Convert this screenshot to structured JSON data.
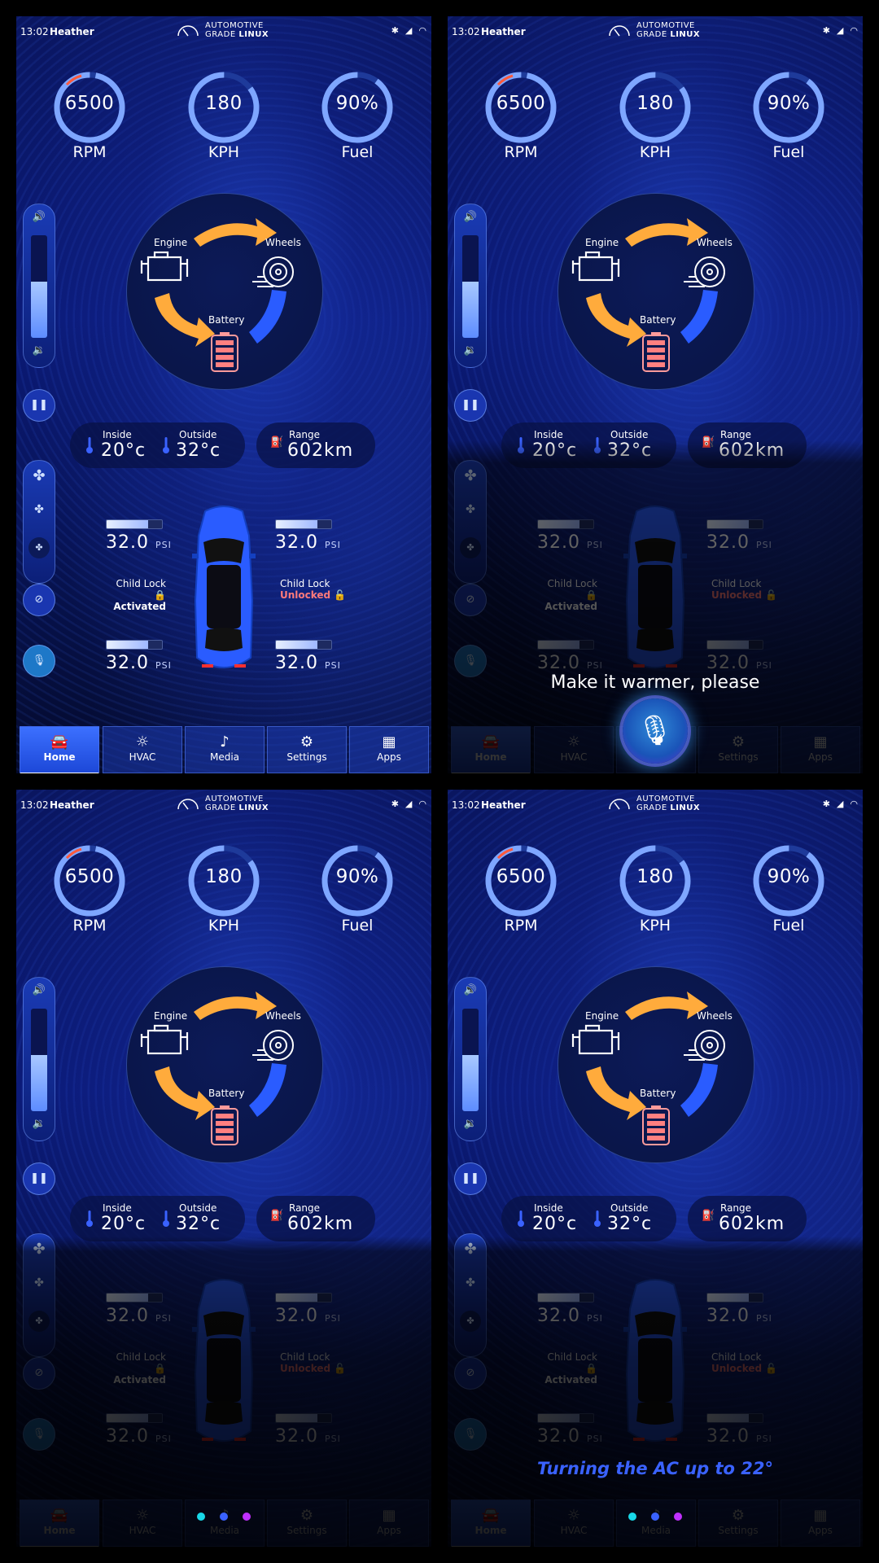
{
  "status": {
    "time": "13:02",
    "user": "Heather",
    "logo_line1": "AUTOMOTIVE",
    "logo_line2a": "GRADE ",
    "logo_line2b": "LINUX",
    "icons": [
      "bluetooth-icon",
      "signal-icon",
      "wifi-icon"
    ]
  },
  "gauges": {
    "rpm": {
      "value": "6500",
      "label": "RPM",
      "level": 0.97
    },
    "kph": {
      "value": "180",
      "label": "KPH",
      "level": 0.85
    },
    "fuel": {
      "value": "90%",
      "label": "Fuel",
      "level": 0.9
    }
  },
  "volume": {
    "level": 0.55
  },
  "flow": {
    "engine": "Engine",
    "wheels": "Wheels",
    "battery": "Battery"
  },
  "env": {
    "inside_label": "Inside",
    "inside_value": "20°c",
    "outside_label": "Outside",
    "outside_value": "32°c",
    "range_label": "Range",
    "range_value": "602km"
  },
  "tires": {
    "front_left": "32.0",
    "front_right": "32.0",
    "rear_left": "32.0",
    "rear_right": "32.0",
    "unit": "PSI",
    "level": 0.75
  },
  "locks": {
    "left_label": "Child Lock",
    "left_state": "Activated",
    "right_label": "Child Lock",
    "right_state": "Unlocked"
  },
  "nav": [
    {
      "label": "Home",
      "icon": "car-icon"
    },
    {
      "label": "HVAC",
      "icon": "hvac-icon"
    },
    {
      "label": "Media",
      "icon": "music-icon"
    },
    {
      "label": "Settings",
      "icon": "gear-icon"
    },
    {
      "label": "Apps",
      "icon": "apps-grid-icon"
    }
  ],
  "voice": {
    "prompt": "Make it warmer, please",
    "response": "Turning the AC up to 22°"
  },
  "colors": {
    "accent": "#3a62ff",
    "arrow_orange": "#ffab3c",
    "arrow_blue": "#2a5cff",
    "unlocked": "#ff7a7a",
    "dot1": "#18d8e8",
    "dot2": "#3a62ff",
    "dot3": "#c030ff"
  }
}
